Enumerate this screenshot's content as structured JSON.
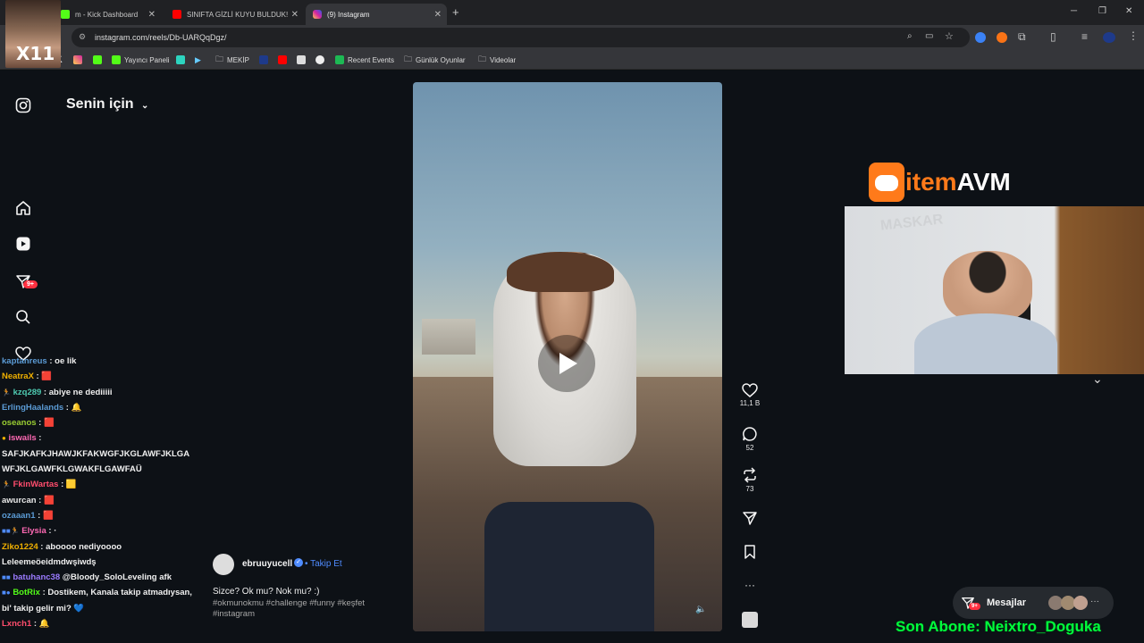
{
  "browser": {
    "tabs": [
      {
        "title": "m - Kick Dashboard",
        "color": "#53fc18"
      },
      {
        "title": "SINIFTA GİZLİ KUYU BULDUK! 🐇",
        "color": "#ff0000"
      },
      {
        "title": "(9) Instagram",
        "color": "#d6249f"
      }
    ],
    "new_tab": "+",
    "url": "instagram.com/reels/Db-UARQqDgz/",
    "window_controls": [
      "─",
      "❐",
      "✕"
    ]
  },
  "bookmarks": [
    {
      "label": "Yayıncı Paneli",
      "color": "#53fc18"
    },
    {
      "label": "MEKİP",
      "color": "#cccccc"
    },
    {
      "label": "Recent Events",
      "color": "#1db954"
    },
    {
      "label": "Günlük Oyunlar",
      "color": "#cccccc"
    },
    {
      "label": "Videolar",
      "color": "#cccccc"
    }
  ],
  "instagram": {
    "feed_title": "Senin için",
    "nav_badge": "9+",
    "post": {
      "username": "ebruuyucell",
      "follow": "Takip Et",
      "caption": "Sizce? Ok mu? Nok mu? :)",
      "tags": "#okmunokmu #challenge #funny #keşfet #instagram"
    },
    "actions": {
      "likes": "11,1 B",
      "comments": "52",
      "reposts": "73"
    },
    "messages": {
      "label": "Mesajlar",
      "badge": "9+"
    }
  },
  "overlay": {
    "sponsor": "itemAVM",
    "sponsor_prefix": "item",
    "sponsor_suffix": "AVM",
    "last_sub": "Son Abone: Neixtro_Doguka"
  },
  "chat": [
    {
      "user": "kaptanreus",
      "msg": "oe lik",
      "color": "#5b9bd5"
    },
    {
      "user": "NeatraX",
      "msg": "🟥",
      "color": "#f0b000"
    },
    {
      "user": "kzq289",
      "msg": "abiye ne dediiiii",
      "color": "#4ec9b0"
    },
    {
      "user": "ErlingHaalands",
      "msg": "🔔",
      "color": "#5b9bd5"
    },
    {
      "user": "oseanos",
      "msg": "🟥",
      "color": "#9acd32"
    },
    {
      "user": "iswails",
      "msg": "SAFJKAFKJHAWJKFAKWGFJKGLAWFJKLGAWFJKLGAWFKLGWAKFLGAWFAÜ",
      "color": "#ff69b4"
    },
    {
      "user": "FkinWartas",
      "msg": "🟨",
      "color": "#ff4d6d"
    },
    {
      "user": "awurcan",
      "msg": "🟥",
      "color": "#e8e8e8"
    },
    {
      "user": "ozaaan1",
      "msg": "🟥",
      "color": "#5b9bd5"
    },
    {
      "user": "Elysia",
      "msg": "·",
      "color": "#ff69b4"
    },
    {
      "user": "Ziko1224",
      "msg": "aboooo nediyoooo Leleemeöeidmdwşiwdş",
      "color": "#f0b000"
    },
    {
      "user": "batuhanc38",
      "msg": "@Bloody_SoloLeveling afk",
      "color": "#9b7bff"
    },
    {
      "user": "BotRix",
      "msg": "Dostikem, Kanala takip atmadıysan, bi' takip gelir mi? 💙",
      "color": "#53fc18"
    },
    {
      "user": "Lxnch1",
      "msg": "🔔",
      "color": "#ff4d6d"
    }
  ],
  "colors": {
    "accent_blue": "#4f8cff",
    "badge_red": "#ff3040",
    "overlay_green": "#00ff3c",
    "sponsor_orange": "#ff7a1a"
  }
}
